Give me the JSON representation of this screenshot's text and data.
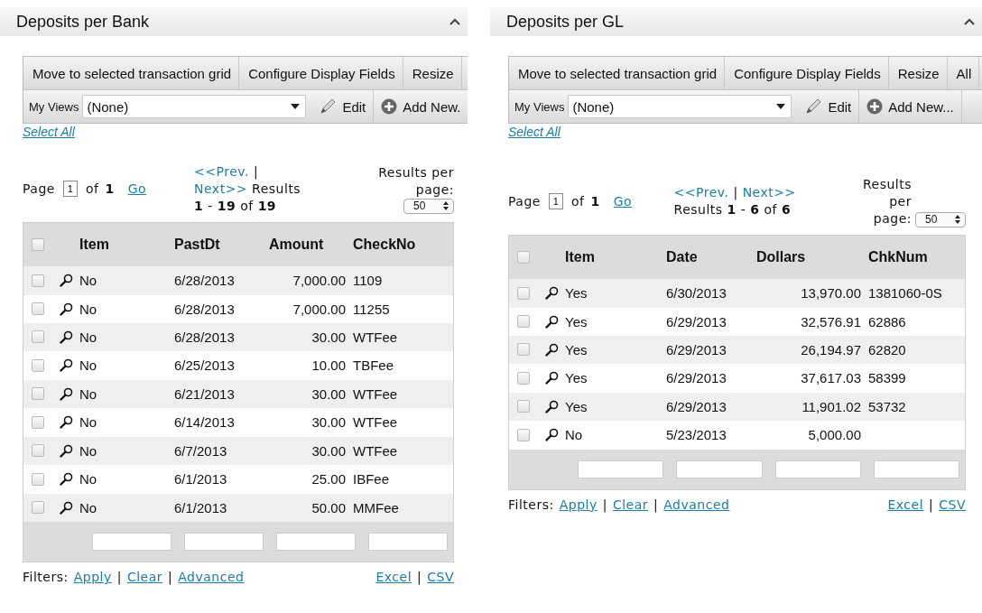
{
  "panels": [
    {
      "title": "Deposits per Bank",
      "toolbar": [
        "Move to selected transaction grid",
        "Configure Display Fields",
        "Resize"
      ],
      "views": {
        "label": "My Views",
        "value": "(None)"
      },
      "view_actions": [
        {
          "kind": "edit",
          "label": "Edit"
        },
        {
          "kind": "add",
          "label": "Add New."
        }
      ],
      "select_all": "Select All",
      "pager": {
        "page_label": "Page",
        "page": "1",
        "of": "of",
        "total": "1",
        "go": "Go",
        "prev": "<<Prev.",
        "separator": "|",
        "next": "Next>>",
        "results_label": "Results",
        "results": "**1** - **19** of **19**",
        "per_page_label": "Results per page:",
        "per_page": "50"
      },
      "table": {
        "columns": [
          "Item",
          "PastDt",
          "Amount",
          "CheckNo"
        ],
        "header_checked": false,
        "rows": [
          {
            "checked": false,
            "cells": [
              "No",
              "6/28/2013",
              "7,000.00",
              "1109"
            ]
          },
          {
            "checked": false,
            "cells": [
              "No",
              "6/28/2013",
              "7,000.00",
              "11255"
            ]
          },
          {
            "checked": false,
            "cells": [
              "No",
              "6/28/2013",
              "30.00",
              "WTFee"
            ]
          },
          {
            "checked": false,
            "cells": [
              "No",
              "6/25/2013",
              "10.00",
              "TBFee"
            ]
          },
          {
            "checked": false,
            "cells": [
              "No",
              "6/21/2013",
              "30.00",
              "WTFee"
            ]
          },
          {
            "checked": false,
            "cells": [
              "No",
              "6/14/2013",
              "30.00",
              "WTFee"
            ]
          },
          {
            "checked": false,
            "cells": [
              "No",
              "6/7/2013",
              "30.00",
              "WTFee"
            ]
          },
          {
            "checked": false,
            "cells": [
              "No",
              "6/1/2013",
              "25.00",
              "IBFee"
            ]
          },
          {
            "checked": false,
            "cells": [
              "No",
              "6/1/2013",
              "50.00",
              "MMFee"
            ]
          }
        ]
      },
      "footer": {
        "filters_label": "Filters:",
        "filter_links": [
          {
            "label": "Apply",
            "separator": "|"
          },
          {
            "label": "Clear",
            "separator": "|"
          },
          {
            "label": "Advanced"
          }
        ],
        "export_links": [
          {
            "label": "Excel",
            "separator": "|"
          },
          {
            "label": "CSV"
          }
        ]
      }
    },
    {
      "title": "Deposits per GL",
      "toolbar": [
        "Move to selected transaction grid",
        "Configure Display Fields",
        "Resize",
        "All"
      ],
      "views": {
        "label": "My Views",
        "value": "(None)"
      },
      "view_actions": [
        {
          "kind": "edit",
          "label": "Edit"
        },
        {
          "kind": "add",
          "label": "Add New..."
        }
      ],
      "select_all": "Select All",
      "pager": {
        "page_label": "Page",
        "page": "1",
        "of": "of",
        "total": "1",
        "go": "Go",
        "prev": "<<Prev.",
        "separator": "|",
        "next": "Next>>",
        "results_label": "Results",
        "results": "**1** - **6** of **6**",
        "per_page_label": "Results per page:",
        "per_page": "50"
      },
      "table": {
        "columns": [
          "Item",
          "Date",
          "Dollars",
          "ChkNum"
        ],
        "header_checked": false,
        "rows": [
          {
            "checked": false,
            "cells": [
              "Yes",
              "6/30/2013",
              "13,970.00",
              "1381060-0S"
            ]
          },
          {
            "checked": false,
            "cells": [
              "Yes",
              "6/29/2013",
              "32,576.91",
              "62886"
            ]
          },
          {
            "checked": false,
            "cells": [
              "Yes",
              "6/29/2013",
              "26,194.97",
              "62820"
            ]
          },
          {
            "checked": false,
            "cells": [
              "Yes",
              "6/29/2013",
              "37,617.03",
              "58399"
            ]
          },
          {
            "checked": false,
            "cells": [
              "Yes",
              "6/29/2013",
              "11,901.02",
              "53732"
            ]
          },
          {
            "checked": false,
            "cells": [
              "No",
              "5/23/2013",
              "5,000.00"
            ]
          }
        ]
      },
      "footer": {
        "filters_label": "Filters:",
        "filter_links": [
          {
            "label": "Apply",
            "separator": "|"
          },
          {
            "label": "Clear",
            "separator": "|"
          },
          {
            "label": "Advanced"
          }
        ],
        "export_links": [
          {
            "label": "Excel",
            "separator": "|"
          },
          {
            "label": "CSV"
          }
        ]
      }
    }
  ]
}
